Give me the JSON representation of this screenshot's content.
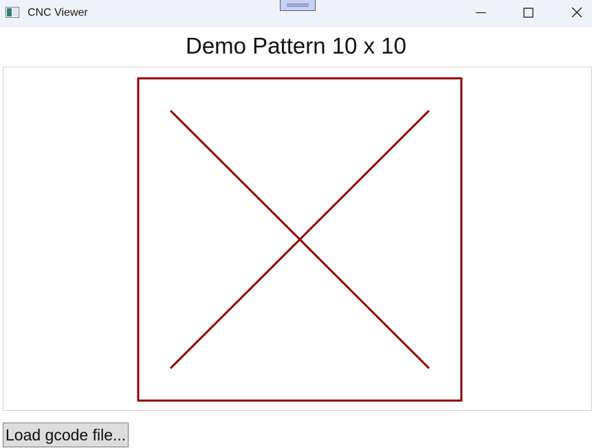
{
  "window": {
    "title": "CNC Viewer",
    "icon": "app-window-icon"
  },
  "caption_buttons": {
    "minimize_icon": "minimize-icon",
    "maximize_icon": "maximize-icon",
    "close_icon": "close-icon"
  },
  "main": {
    "heading": "Demo Pattern 10 x 10",
    "toolpath_color": "#8b0000",
    "load_button_label": "Load gcode file..."
  }
}
